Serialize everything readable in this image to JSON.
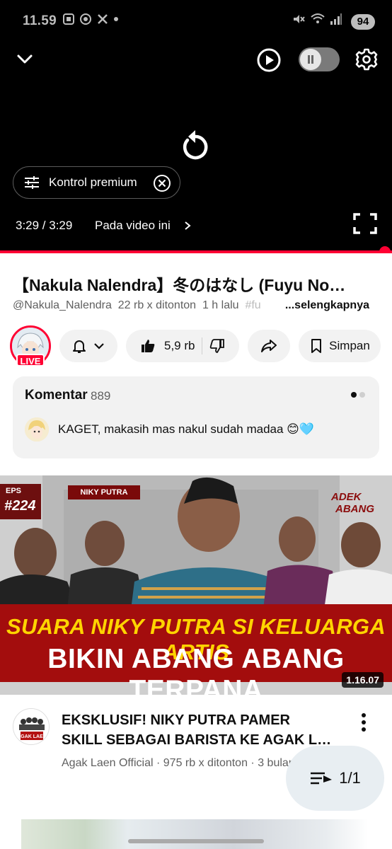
{
  "status_bar": {
    "time": "11.59",
    "battery": "94"
  },
  "player": {
    "premium_chip_label": "Kontrol premium",
    "time_display": "3:29 / 3:29",
    "on_video_label": "Pada video ini",
    "progress_fraction": 1.0
  },
  "video": {
    "title": "【Nakula Nalendra】冬のはなし (Fuyu No…",
    "channel_handle": "@Nakula_Nalendra",
    "views": "22 rb x ditonton",
    "age": "1 h lalu",
    "tags_fade": "#fu",
    "more_label": "...selengkapnya",
    "live_badge": "LIVE",
    "like_count": "5,9 rb",
    "save_label": "Simpan"
  },
  "comments": {
    "title": "Komentar",
    "count": "889",
    "top_comment": "KAGET, makasih mas nakul sudah madaa 😊🩵"
  },
  "thumbnail": {
    "episode_label": "EPS",
    "episode_number": "#224",
    "guest_tag": "NIKY PUTRA",
    "brand_line1": "ADEK",
    "brand_line2": "ABANG",
    "headline_line1": "SUARA NIKY PUTRA SI KELUARGA ARTIS",
    "headline_line2": "BIKIN ABANG ABANG TERPANA",
    "duration": "1.16.07"
  },
  "next_video": {
    "channel_avatar_text": "AGAK LAEN",
    "title_line1": "EKSKLUSIF! NIKY PUTRA PAMER",
    "title_line2": "SKILL SEBAGAI BARISTA KE AGAK L…",
    "meta": "Agak Laen Official · 975 rb x ditonton · 3 bulan yang lalu"
  },
  "miniplayer": {
    "label": "1/1"
  },
  "colors": {
    "accent_red": "#ff0033",
    "chip_gray": "#f2f2f2",
    "headline_yellow": "#ffd400"
  }
}
